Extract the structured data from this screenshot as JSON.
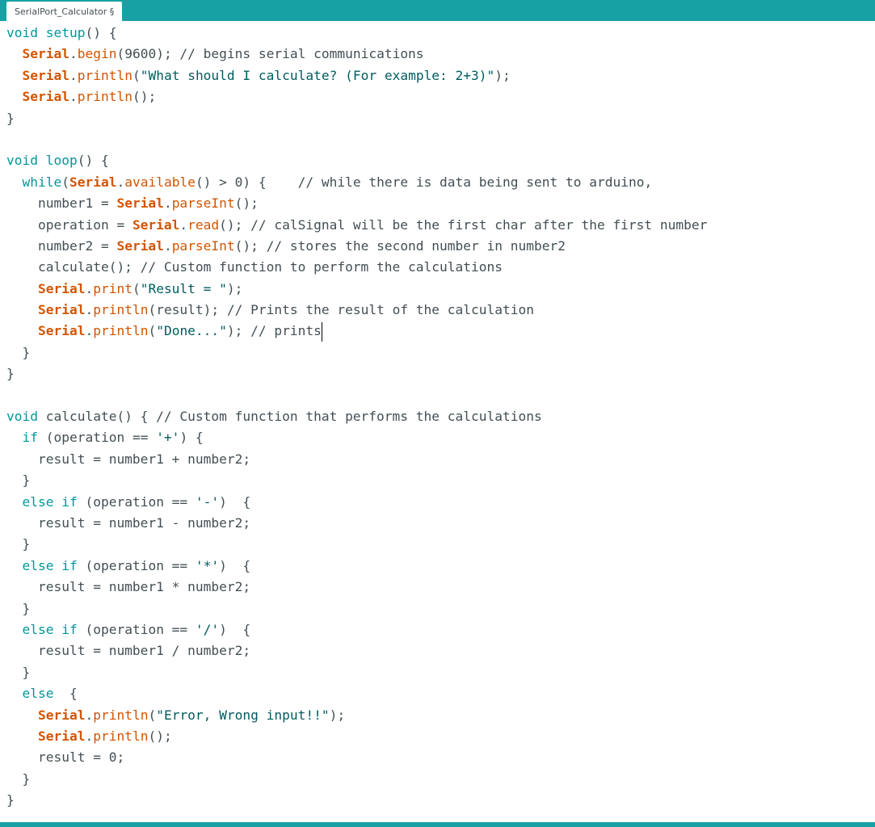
{
  "window": {
    "tab_title": "SerialPort_Calculator §"
  },
  "colors": {
    "teal_bar": "#17a1a5",
    "keyword": "#00979c",
    "serial": "#d35400",
    "string": "#005c5f",
    "text": "#434f54"
  },
  "code_lines": [
    [
      [
        "kw",
        "void"
      ],
      [
        "plain",
        " "
      ],
      [
        "kw",
        "setup"
      ],
      [
        "plain",
        "() {"
      ]
    ],
    [
      [
        "plain",
        "  "
      ],
      [
        "serial",
        "Serial"
      ],
      [
        "plain",
        "."
      ],
      [
        "fn",
        "begin"
      ],
      [
        "plain",
        "(9600); // begins serial communications"
      ]
    ],
    [
      [
        "plain",
        "  "
      ],
      [
        "serial",
        "Serial"
      ],
      [
        "plain",
        "."
      ],
      [
        "fn",
        "println"
      ],
      [
        "plain",
        "("
      ],
      [
        "str",
        "\"What should I calculate? (For example: 2+3)\""
      ],
      [
        "plain",
        ");"
      ]
    ],
    [
      [
        "plain",
        "  "
      ],
      [
        "serial",
        "Serial"
      ],
      [
        "plain",
        "."
      ],
      [
        "fn",
        "println"
      ],
      [
        "plain",
        "();"
      ]
    ],
    [
      [
        "plain",
        "}"
      ]
    ],
    [],
    [
      [
        "kw",
        "void"
      ],
      [
        "plain",
        " "
      ],
      [
        "kw",
        "loop"
      ],
      [
        "plain",
        "() {"
      ]
    ],
    [
      [
        "plain",
        "  "
      ],
      [
        "kw",
        "while"
      ],
      [
        "plain",
        "("
      ],
      [
        "serial",
        "Serial"
      ],
      [
        "plain",
        "."
      ],
      [
        "fn",
        "available"
      ],
      [
        "plain",
        "() > 0) {    // while there is data being sent to arduino,"
      ]
    ],
    [
      [
        "plain",
        "    number1 = "
      ],
      [
        "serial",
        "Serial"
      ],
      [
        "plain",
        "."
      ],
      [
        "fn",
        "parseInt"
      ],
      [
        "plain",
        "();"
      ]
    ],
    [
      [
        "plain",
        "    operation = "
      ],
      [
        "serial",
        "Serial"
      ],
      [
        "plain",
        "."
      ],
      [
        "fn",
        "read"
      ],
      [
        "plain",
        "(); // calSignal will be the first char after the first number"
      ]
    ],
    [
      [
        "plain",
        "    number2 = "
      ],
      [
        "serial",
        "Serial"
      ],
      [
        "plain",
        "."
      ],
      [
        "fn",
        "parseInt"
      ],
      [
        "plain",
        "(); // stores the second number in number2"
      ]
    ],
    [
      [
        "plain",
        "    calculate(); // Custom function to perform the calculations"
      ]
    ],
    [
      [
        "plain",
        "    "
      ],
      [
        "serial",
        "Serial"
      ],
      [
        "plain",
        "."
      ],
      [
        "fn",
        "print"
      ],
      [
        "plain",
        "("
      ],
      [
        "str",
        "\"Result = \""
      ],
      [
        "plain",
        ");"
      ]
    ],
    [
      [
        "plain",
        "    "
      ],
      [
        "serial",
        "Serial"
      ],
      [
        "plain",
        "."
      ],
      [
        "fn",
        "println"
      ],
      [
        "plain",
        "(result); // Prints the result of the calculation"
      ]
    ],
    [
      [
        "plain",
        "    "
      ],
      [
        "serial",
        "Serial"
      ],
      [
        "plain",
        "."
      ],
      [
        "fn",
        "println"
      ],
      [
        "plain",
        "("
      ],
      [
        "str",
        "\"Done...\""
      ],
      [
        "plain",
        "); // prints"
      ],
      [
        "caret",
        ""
      ]
    ],
    [
      [
        "plain",
        "  }"
      ]
    ],
    [
      [
        "plain",
        "}"
      ]
    ],
    [],
    [
      [
        "kw",
        "void"
      ],
      [
        "plain",
        " calculate() { // Custom function that performs the calculations"
      ]
    ],
    [
      [
        "plain",
        "  "
      ],
      [
        "kw",
        "if"
      ],
      [
        "plain",
        " (operation == "
      ],
      [
        "str",
        "'+'"
      ],
      [
        "plain",
        ") {"
      ]
    ],
    [
      [
        "plain",
        "    result = number1 + number2;"
      ]
    ],
    [
      [
        "plain",
        "  }"
      ]
    ],
    [
      [
        "plain",
        "  "
      ],
      [
        "kw",
        "else"
      ],
      [
        "plain",
        " "
      ],
      [
        "kw",
        "if"
      ],
      [
        "plain",
        " (operation == "
      ],
      [
        "str",
        "'-'"
      ],
      [
        "plain",
        ")  {"
      ]
    ],
    [
      [
        "plain",
        "    result = number1 - number2;"
      ]
    ],
    [
      [
        "plain",
        "  }"
      ]
    ],
    [
      [
        "plain",
        "  "
      ],
      [
        "kw",
        "else"
      ],
      [
        "plain",
        " "
      ],
      [
        "kw",
        "if"
      ],
      [
        "plain",
        " (operation == "
      ],
      [
        "str",
        "'*'"
      ],
      [
        "plain",
        ")  {"
      ]
    ],
    [
      [
        "plain",
        "    result = number1 * number2;"
      ]
    ],
    [
      [
        "plain",
        "  }"
      ]
    ],
    [
      [
        "plain",
        "  "
      ],
      [
        "kw",
        "else"
      ],
      [
        "plain",
        " "
      ],
      [
        "kw",
        "if"
      ],
      [
        "plain",
        " (operation == "
      ],
      [
        "str",
        "'/'"
      ],
      [
        "plain",
        ")  {"
      ]
    ],
    [
      [
        "plain",
        "    result = number1 / number2;"
      ]
    ],
    [
      [
        "plain",
        "  }"
      ]
    ],
    [
      [
        "plain",
        "  "
      ],
      [
        "kw",
        "else"
      ],
      [
        "plain",
        "  {"
      ]
    ],
    [
      [
        "plain",
        "    "
      ],
      [
        "serial",
        "Serial"
      ],
      [
        "plain",
        "."
      ],
      [
        "fn",
        "println"
      ],
      [
        "plain",
        "("
      ],
      [
        "str",
        "\"Error, Wrong input!!\""
      ],
      [
        "plain",
        ");"
      ]
    ],
    [
      [
        "plain",
        "    "
      ],
      [
        "serial",
        "Serial"
      ],
      [
        "plain",
        "."
      ],
      [
        "fn",
        "println"
      ],
      [
        "plain",
        "();"
      ]
    ],
    [
      [
        "plain",
        "    result = 0;"
      ]
    ],
    [
      [
        "plain",
        "  }"
      ]
    ],
    [
      [
        "plain",
        "}"
      ]
    ]
  ]
}
